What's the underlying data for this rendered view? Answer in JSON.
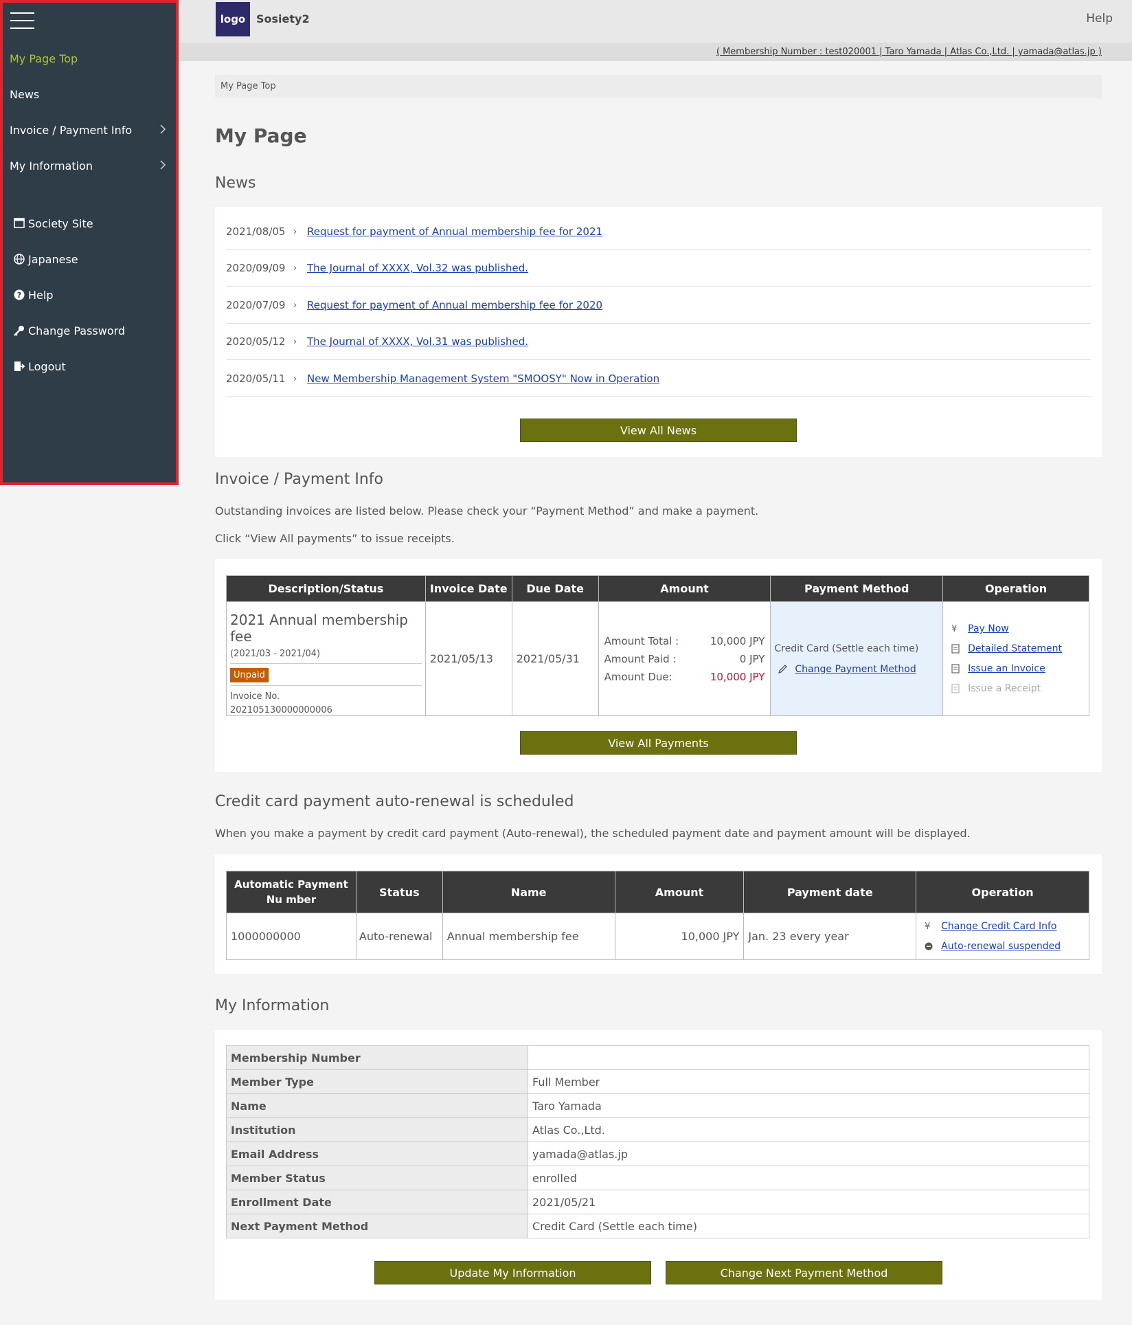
{
  "sidebar": {
    "items": [
      {
        "label": "My Page Top"
      },
      {
        "label": "News"
      },
      {
        "label": "Invoice / Payment Info"
      },
      {
        "label": "My Information"
      },
      {
        "label": "Society Site"
      },
      {
        "label": "Japanese"
      },
      {
        "label": "Help"
      },
      {
        "label": "Change Password"
      },
      {
        "label": "Logout"
      }
    ]
  },
  "header": {
    "logo": "logo",
    "site_name": "Sosiety2",
    "help": "Help",
    "member_info": "( Membership Number : test020001 | Taro Yamada | Atlas Co.,Ltd. | yamada@atlas.jp )"
  },
  "breadcrumb": "My Page Top",
  "page_title": "My Page",
  "news": {
    "title": "News",
    "items": [
      {
        "date": "2021/08/05",
        "text": "Request for payment of Annual membership fee for 2021"
      },
      {
        "date": "2020/09/09",
        "text": "The Journal of XXXX, Vol.32 was published."
      },
      {
        "date": "2020/07/09",
        "text": "Request for payment of Annual membership fee for 2020"
      },
      {
        "date": "2020/05/12",
        "text": "The Journal of XXXX, Vol.31 was published."
      },
      {
        "date": "2020/05/11",
        "text": "New Membership Management System \"SMOOSY\" Now in Operation"
      }
    ],
    "view_all": "View All News"
  },
  "invoice": {
    "title": "Invoice / Payment Info",
    "desc1": "Outstanding invoices are listed below. Please check your “Payment Method” and make a payment.",
    "desc2": "Click “View All payments” to issue receipts.",
    "headers": [
      "Description/Status",
      "Invoice Date",
      "Due Date",
      "Amount",
      "Payment Method",
      "Operation"
    ],
    "row": {
      "description": "2021 Annual membership fee",
      "period": "(2021/03 - 2021/04)",
      "status": "Unpaid",
      "invoice_no_label": "Invoice No.",
      "invoice_no": "202105130000000006",
      "invoice_date": "2021/05/13",
      "due_date": "2021/05/31",
      "amount_total_label": "Amount Total :",
      "amount_total": "10,000 JPY",
      "amount_paid_label": "Amount Paid :",
      "amount_paid": "0 JPY",
      "amount_due_label": "Amount Due:",
      "amount_due": "10,000 JPY",
      "payment_method": "Credit Card (Settle each time)",
      "change_method": "Change Payment Method",
      "ops": [
        "Pay Now",
        "Detailed Statement",
        "Issue an Invoice",
        "Issue a Receipt"
      ]
    },
    "view_all": "View All Payments"
  },
  "autorenew": {
    "title": "Credit card payment auto-renewal is scheduled",
    "desc": "When you make a payment by credit card payment (Auto-renewal), the scheduled payment date and payment amount will be displayed.",
    "headers": [
      "Automatic Payment Nu mber",
      "Status",
      "Name",
      "Amount",
      "Payment date",
      "Operation"
    ],
    "row": {
      "number": "1000000000",
      "status": "Auto-renewal",
      "name": "Annual membership fee",
      "amount": "10,000 JPY",
      "date": "Jan. 23 every year",
      "ops": [
        "Change Credit Card Info",
        "Auto-renewal suspended"
      ]
    }
  },
  "myinfo": {
    "title": "My Information",
    "rows": [
      {
        "k": "Membership Number",
        "v": ""
      },
      {
        "k": "Member Type",
        "v": "Full Member"
      },
      {
        "k": "Name",
        "v": "Taro Yamada"
      },
      {
        "k": "Institution",
        "v": "Atlas Co.,Ltd."
      },
      {
        "k": "Email Address",
        "v": "yamada@atlas.jp"
      },
      {
        "k": "Member Status",
        "v": "enrolled"
      },
      {
        "k": "Enrollment Date",
        "v": "2021/05/21"
      },
      {
        "k": "Next Payment Method",
        "v": "Credit Card (Settle each time)"
      }
    ],
    "update_button": "Update My Information",
    "change_method_button": "Change Next Payment Method"
  },
  "colors": {
    "sidebar_bg": "#2e3d48",
    "active_nav": "#a9c62a",
    "button_bg": "#6c7110",
    "unpaid_badge": "#c85a00",
    "amount_due": "#d0103a",
    "link": "#1a3fb8"
  }
}
